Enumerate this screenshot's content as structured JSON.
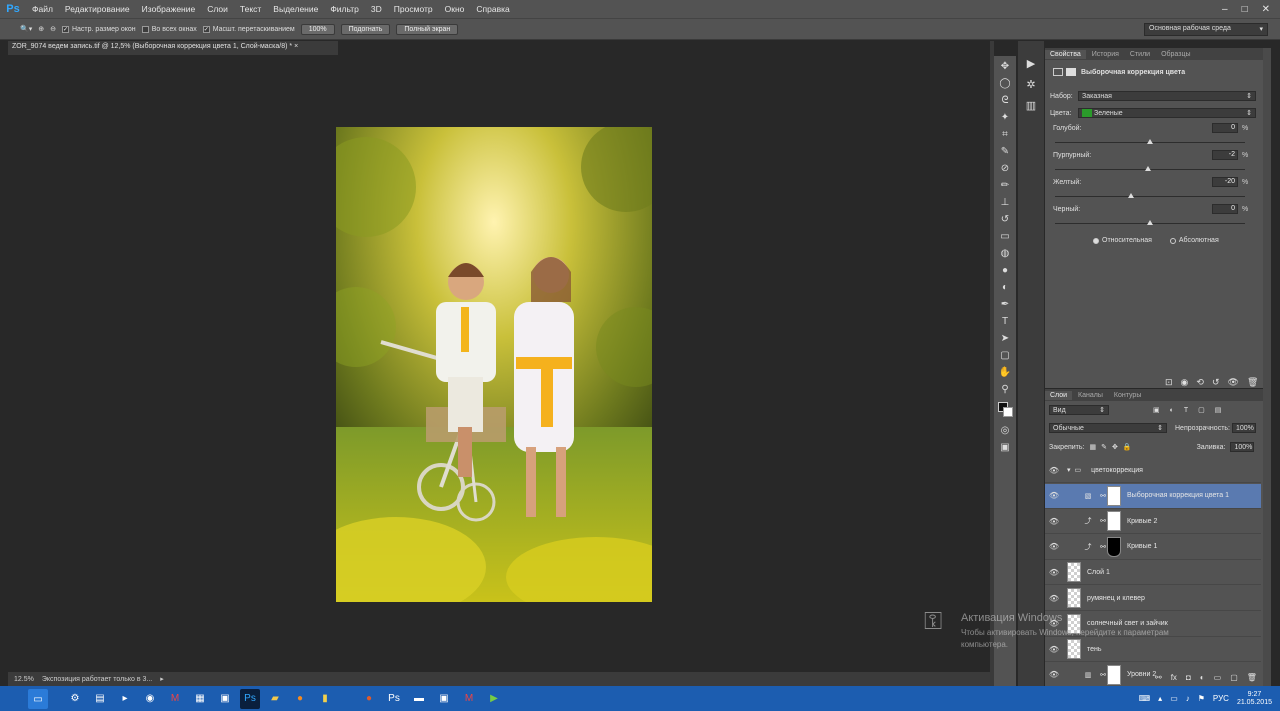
{
  "app_logo": "Ps",
  "menu": [
    "Файл",
    "Редактирование",
    "Изображение",
    "Слои",
    "Текст",
    "Выделение",
    "Фильтр",
    "3D",
    "Просмотр",
    "Окно",
    "Справка"
  ],
  "options": {
    "resize_windows": "Настр. размер окон",
    "all_windows": "Во всех окнах",
    "scrubby_zoom": "Масшт. перетаскиванием",
    "zoom_value": "100%",
    "fit_button": "Подогнать",
    "fill_screen_button": "Полный экран",
    "workspace": "Основная рабочая среда"
  },
  "document_tab": "ZOR_9074 ведем запись.tif @ 12,5% (Выборочная коррекция цвета 1, Слой-маска/8) *",
  "status": {
    "zoom": "12.5%",
    "info": "Экспозиция работает только в 3..."
  },
  "properties": {
    "tabs": [
      "Свойства",
      "История",
      "Стили",
      "Образцы"
    ],
    "title": "Выборочная коррекция цвета",
    "preset_label": "Набор:",
    "preset_value": "Заказная",
    "colors_label": "Цвета:",
    "colors_value": "Зеленые",
    "sliders": [
      {
        "label": "Голубой:",
        "value": "0",
        "unit": "%",
        "pos": 0.5
      },
      {
        "label": "Пурпурный:",
        "value": "-2",
        "unit": "%",
        "pos": 0.49
      },
      {
        "label": "Желтый:",
        "value": "-20",
        "unit": "%",
        "pos": 0.4
      },
      {
        "label": "Черный:",
        "value": "0",
        "unit": "%",
        "pos": 0.5
      }
    ],
    "method_relative": "Относительная",
    "method_absolute": "Абсолютная"
  },
  "layers_panel": {
    "tabs": [
      "Слои",
      "Каналы",
      "Контуры"
    ],
    "filter": "Вид",
    "blend_mode": "Обычные",
    "opacity_label": "Непрозрачность:",
    "opacity_value": "100%",
    "lock_label": "Закрепить:",
    "fill_label": "Заливка:",
    "fill_value": "100%",
    "layers": [
      {
        "name": "цветокоррекция"
      },
      {
        "name": "Выборочная коррекция цвета 1"
      },
      {
        "name": "Кривые 2"
      },
      {
        "name": "Кривые 1"
      },
      {
        "name": "Слой 1"
      },
      {
        "name": "румянец и клевер"
      },
      {
        "name": "солнечный свет и зайчик"
      },
      {
        "name": "тень"
      },
      {
        "name": "Уровни 2"
      }
    ]
  },
  "watermark": {
    "line1": "Активация Windows",
    "line2": "Чтобы активировать Windows, перейдите к параметрам",
    "line3": "компьютера."
  },
  "taskbar": {
    "lang": "РУС",
    "time": "9:27",
    "date": "21.05.2015"
  },
  "colors": {
    "ps_blue": "#31a8ff",
    "panel": "#535353",
    "canvas": "#282828",
    "selected_layer": "#5a7ab0",
    "taskbar": "#1c5db0",
    "green_swatch": "#2a9a2a"
  }
}
